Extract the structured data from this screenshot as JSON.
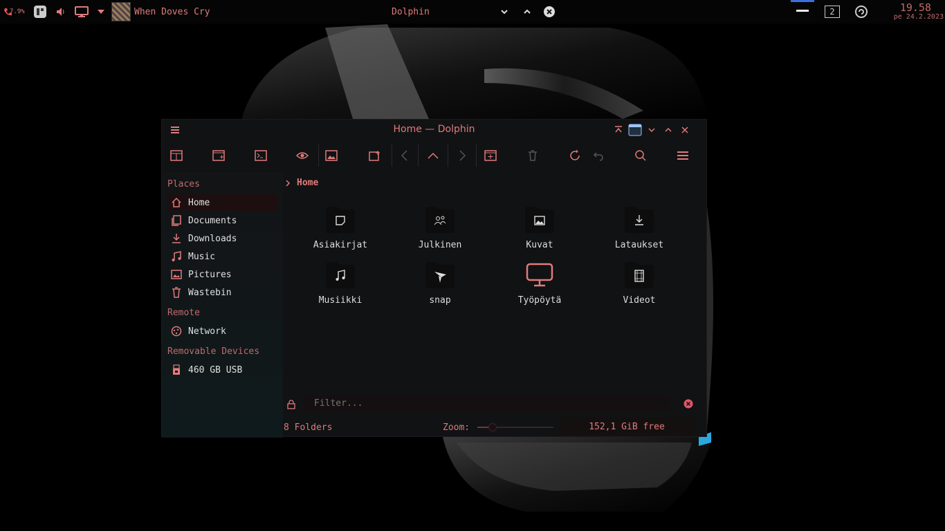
{
  "panel": {
    "battery": "7.9%",
    "now_playing": "When Doves Cry",
    "active_window": "Dolphin",
    "desktop_number": "2",
    "time": "19.58",
    "date": "pe 24.2.2023"
  },
  "window": {
    "title": "Home — Dolphin"
  },
  "sidebar": {
    "places_title": "Places",
    "places": [
      {
        "label": "Home",
        "icon": "home-icon"
      },
      {
        "label": "Documents",
        "icon": "documents-icon"
      },
      {
        "label": "Downloads",
        "icon": "downloads-icon"
      },
      {
        "label": "Music",
        "icon": "music-icon"
      },
      {
        "label": "Pictures",
        "icon": "pictures-icon"
      },
      {
        "label": "Wastebin",
        "icon": "trash-icon"
      }
    ],
    "remote_title": "Remote",
    "remote": [
      {
        "label": "Network",
        "icon": "network-icon"
      }
    ],
    "devices_title": "Removable Devices",
    "devices": [
      {
        "label": "460 GB USB",
        "icon": "usb-icon"
      }
    ]
  },
  "breadcrumb": {
    "current": "Home"
  },
  "folders": [
    {
      "label": "Asiakirjat",
      "icon": "document-folder-icon"
    },
    {
      "label": "Julkinen",
      "icon": "public-folder-icon"
    },
    {
      "label": "Kuvat",
      "icon": "pictures-folder-icon"
    },
    {
      "label": "Lataukset",
      "icon": "downloads-folder-icon"
    },
    {
      "label": "Musiikki",
      "icon": "music-folder-icon"
    },
    {
      "label": "snap",
      "icon": "snap-folder-icon"
    },
    {
      "label": "Työpöytä",
      "icon": "desktop-folder-icon"
    },
    {
      "label": "Videot",
      "icon": "videos-folder-icon"
    }
  ],
  "filter": {
    "placeholder": "Filter..."
  },
  "status": {
    "count": "8 Folders",
    "zoom_label": "Zoom:",
    "zoom_level": 0.2,
    "free_space": "152,1 GiB free"
  },
  "colors": {
    "accent": "#e07b7b",
    "background": "#111214",
    "panel_highlight": "#3c6ee0"
  }
}
